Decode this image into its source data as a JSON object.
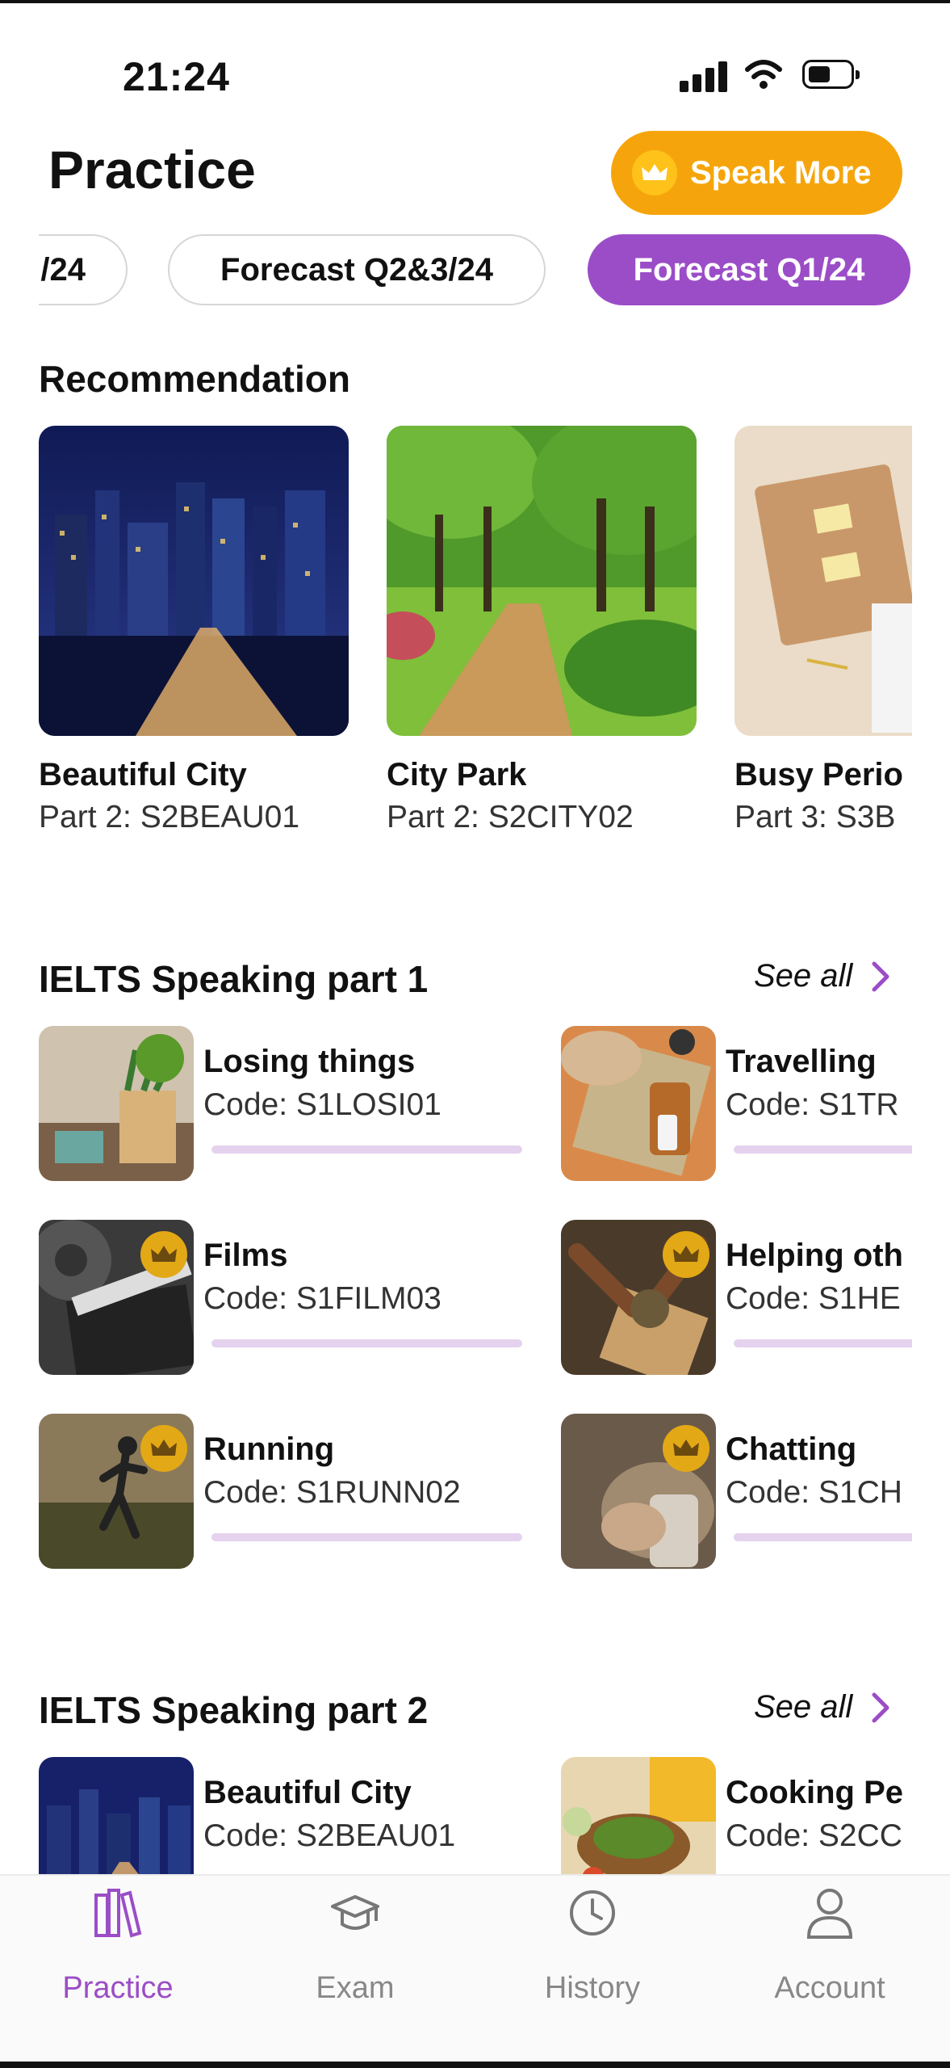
{
  "status_bar": {
    "time": "21:24"
  },
  "header": {
    "title": "Practice",
    "speak_more_label": "Speak More"
  },
  "filter_chips": [
    {
      "label": "/24",
      "active": false
    },
    {
      "label": "Forecast Q2&3/24",
      "active": false
    },
    {
      "label": "Forecast Q1/24",
      "active": true
    }
  ],
  "recommendation": {
    "title": "Recommendation",
    "items": [
      {
        "title": "Beautiful City",
        "code": "Part 2: S2BEAU01"
      },
      {
        "title": "City Park",
        "code": "Part 2: S2CITY02"
      },
      {
        "title": "Busy Perio",
        "code": "Part 3: S3B"
      }
    ]
  },
  "speaking_part1": {
    "title": "IELTS Speaking part 1",
    "see_all": "See all",
    "items": [
      {
        "title": "Losing things",
        "code": "Code: S1LOSI01",
        "premium": false
      },
      {
        "title": "Travelling",
        "code": "Code: S1TR",
        "premium": false
      },
      {
        "title": "Films",
        "code": "Code: S1FILM03",
        "premium": true
      },
      {
        "title": "Helping oth",
        "code": "Code: S1HE",
        "premium": true
      },
      {
        "title": "Running",
        "code": "Code: S1RUNN02",
        "premium": true
      },
      {
        "title": "Chatting",
        "code": "Code: S1CH",
        "premium": true
      }
    ]
  },
  "speaking_part2": {
    "title": "IELTS Speaking part 2",
    "see_all": "See all",
    "items": [
      {
        "title": "Beautiful City",
        "code": "Code: S2BEAU01"
      },
      {
        "title": "Cooking Pe",
        "code": "Code: S2CC"
      }
    ]
  },
  "bottom_nav": [
    {
      "label": "Practice",
      "icon": "books-icon",
      "active": true
    },
    {
      "label": "Exam",
      "icon": "graduation-cap-icon",
      "active": false
    },
    {
      "label": "History",
      "icon": "clock-icon",
      "active": false
    },
    {
      "label": "Account",
      "icon": "person-icon",
      "active": false
    }
  ],
  "colors": {
    "accent": "#9b4dc7",
    "premium": "#f5a50b",
    "progress_track": "#e5d2ee"
  }
}
